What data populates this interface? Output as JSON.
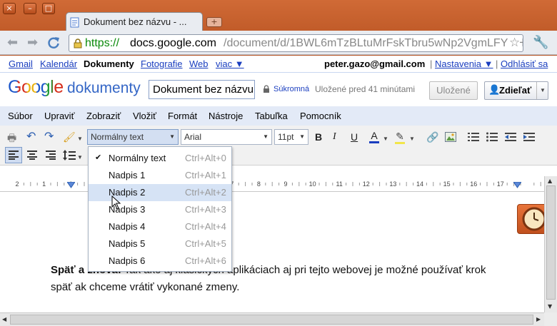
{
  "browser": {
    "window_buttons": [
      "×",
      "–",
      "□"
    ],
    "tab_title": "Dokument bez názvu - ...",
    "new_tab": "+",
    "url_scheme": "https://",
    "url_domain": "docs.google.com",
    "url_path": "/document/d/1BWL6mTzBLtuMrFskTbru5wNp2VgmLFYRH23..."
  },
  "gbar": {
    "links": [
      "Gmail",
      "Kalendár"
    ],
    "active": "Dokumenty",
    "links2": [
      "Fotografie",
      "Web"
    ],
    "more": "viac ▼",
    "email": "peter.gazo@gmail.com",
    "settings": "Nastavenia ▼",
    "signout": "Odhlásiť sa",
    "separator": "|"
  },
  "header": {
    "logo_google": "Google",
    "logo_product": "dokumenty",
    "doc_title": "Dokument bez názvu",
    "privacy": "Súkromná",
    "saved_status": "Uložené pred 41 minútami",
    "save_button": "Uložené",
    "share_button": "Zdieľať"
  },
  "menubar": {
    "items": [
      "Súbor",
      "Upraviť",
      "Zobraziť",
      "Vložiť",
      "Formát",
      "Nástroje",
      "Tabuľka",
      "Pomocník"
    ]
  },
  "toolbar": {
    "style_select": "Normálny text",
    "font_select": "Arial",
    "size_select": "11pt"
  },
  "ruler": {
    "labels": [
      "2",
      "1",
      "1",
      "2",
      "3",
      "4",
      "5",
      "6",
      "7",
      "8",
      "9",
      "10",
      "11",
      "12",
      "13",
      "14",
      "15",
      "16",
      "17"
    ]
  },
  "dropdown": {
    "items": [
      {
        "label": "Normálny text",
        "shortcut": "Ctrl+Alt+0",
        "checked": true
      },
      {
        "label": "Nadpis 1",
        "shortcut": "Ctrl+Alt+1",
        "checked": false
      },
      {
        "label": "Nadpis 2",
        "shortcut": "Ctrl+Alt+2",
        "checked": false
      },
      {
        "label": "Nadpis 3",
        "shortcut": "Ctrl+Alt+3",
        "checked": false
      },
      {
        "label": "Nadpis 4",
        "shortcut": "Ctrl+Alt+4",
        "checked": false
      },
      {
        "label": "Nadpis 5",
        "shortcut": "Ctrl+Alt+5",
        "checked": false
      },
      {
        "label": "Nadpis 6",
        "shortcut": "Ctrl+Alt+6",
        "checked": false
      }
    ],
    "highlighted_index": 2,
    "check_mark": "✔"
  },
  "document": {
    "line1_bold": "Späť a znova:",
    "line1_partial": "Tak ako aj klasických aplikáciach aj pri tejto webovej je možné používať krok",
    "line2": "späť ak chceme vrátiť vykonané zmeny."
  },
  "colors": {
    "chrome": "#c65a28",
    "menubar": "#e3eaf7",
    "highlight": "#d6e3f5",
    "link": "#1a3ebf"
  }
}
